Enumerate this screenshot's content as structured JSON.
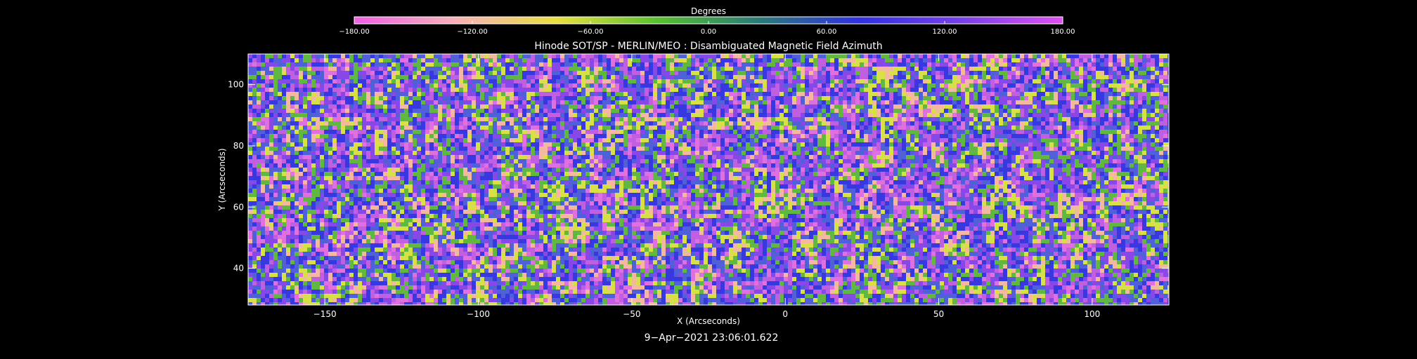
{
  "chart_data": {
    "type": "heatmap",
    "title": "Hinode SOT/SP - MERLIN/MEO : Disambiguated Magnetic Field Azimuth",
    "xlabel": "X (Arcseconds)",
    "ylabel": "Y (Arcseconds)",
    "xlim": [
      -175,
      125
    ],
    "ylim": [
      28,
      110
    ],
    "x_ticks": [
      -150,
      -100,
      -50,
      0,
      50,
      100
    ],
    "x_tick_labels": [
      "−150",
      "−100",
      "−50",
      "0",
      "50",
      "100"
    ],
    "y_ticks": [
      40,
      60,
      80,
      100
    ],
    "y_tick_labels": [
      "40",
      "60",
      "80",
      "100"
    ],
    "colorbar": {
      "label": "Degrees",
      "range": [
        -180,
        180
      ],
      "ticks": [
        -180,
        -120,
        -60,
        0,
        60,
        120,
        180
      ],
      "tick_labels": [
        "−180.00",
        "−120.00",
        "−60.00",
        "0.00",
        "60.00",
        "120.00",
        "180.00"
      ],
      "colors": [
        "#f060e8",
        "#f8b0b8",
        "#e8e040",
        "#58c030",
        "#2a7a78",
        "#3030e0",
        "#7840e8",
        "#e050f0"
      ]
    },
    "field_description_colors": [
      "#e070e0",
      "#f4b8a0",
      "#d8e048",
      "#60b840",
      "#5060d8",
      "#3838e0",
      "#8848e8",
      "#c060e0"
    ]
  },
  "timestamp": "9−Apr−2021 23:06:01.622"
}
